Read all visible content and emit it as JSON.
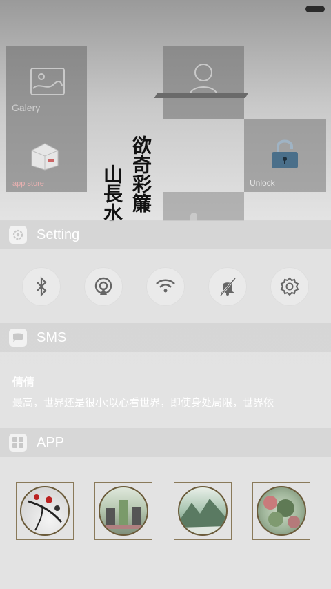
{
  "home": {
    "tiles": {
      "galery": "Galery",
      "app_store": "app store",
      "contact": "",
      "unlock": "Unlock"
    },
    "calligraphy": {
      "col_right": "欲奇彩簾",
      "col_left": "山長水"
    }
  },
  "panel": {
    "setting": {
      "title": "Setting",
      "toggles": [
        {
          "icon": "bluetooth-icon"
        },
        {
          "icon": "hotspot-icon"
        },
        {
          "icon": "wifi-icon"
        },
        {
          "icon": "mute-icon"
        },
        {
          "icon": "gear-icon"
        }
      ]
    },
    "sms": {
      "title": "SMS",
      "sender": "倩倩",
      "body": "最高，世界还是很小;以心看世界，即使身处局限，世界依"
    },
    "app": {
      "title": "APP",
      "apps": [
        {
          "icon": "painting-plum-icon"
        },
        {
          "icon": "painting-pavilion-icon"
        },
        {
          "icon": "painting-landscape-icon"
        },
        {
          "icon": "painting-forest-icon"
        }
      ]
    }
  },
  "colors": {
    "frame": "#8a7a5a",
    "lock_accent": "#4a6f8a"
  }
}
